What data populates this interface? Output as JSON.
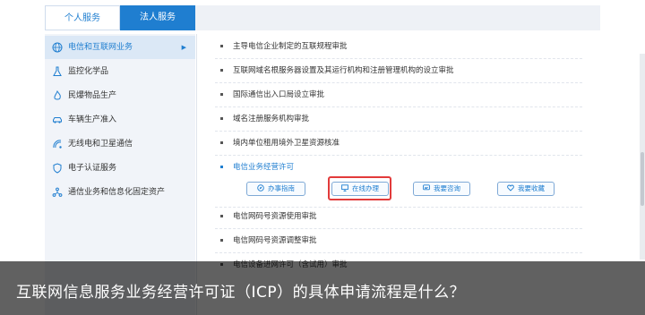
{
  "tabs": {
    "personal": "个人服务",
    "legal": "法人服务"
  },
  "sidebar": {
    "items": [
      {
        "label": "电信和互联网业务",
        "icon": "globe-icon",
        "active": true
      },
      {
        "label": "监控化学品",
        "icon": "flask-icon",
        "active": false
      },
      {
        "label": "民爆物品生产",
        "icon": "fire-icon",
        "active": false
      },
      {
        "label": "车辆生产准入",
        "icon": "car-icon",
        "active": false
      },
      {
        "label": "无线电和卫星通信",
        "icon": "satellite-icon",
        "active": false
      },
      {
        "label": "电子认证服务",
        "icon": "shield-icon",
        "active": false
      },
      {
        "label": "通信业务和信息化固定资产",
        "icon": "network-icon",
        "active": false
      }
    ],
    "active_arrow": "▶"
  },
  "main": {
    "items": [
      "主导电信企业制定的互联规程审批",
      "互联网域名根服务器设置及其运行机构和注册管理机构的设立审批",
      "国际通信出入口局设立审批",
      "域名注册服务机构审批",
      "境内单位租用境外卫星资源核准",
      "电信业务经营许可",
      "电信网码号资源使用审批",
      "电信网码号资源调整审批",
      "电信设备进网许可（含试用）审批"
    ],
    "buttons": {
      "guide": "办事指南",
      "online": "在线办理",
      "consult": "我要咨询",
      "favorite": "我要收藏"
    }
  },
  "caption": "互联网信息服务业务经营许可证（ICP）的具体申请流程是什么？",
  "colors": {
    "accent": "#1f7ed0",
    "highlight_box": "#e23b3b"
  }
}
